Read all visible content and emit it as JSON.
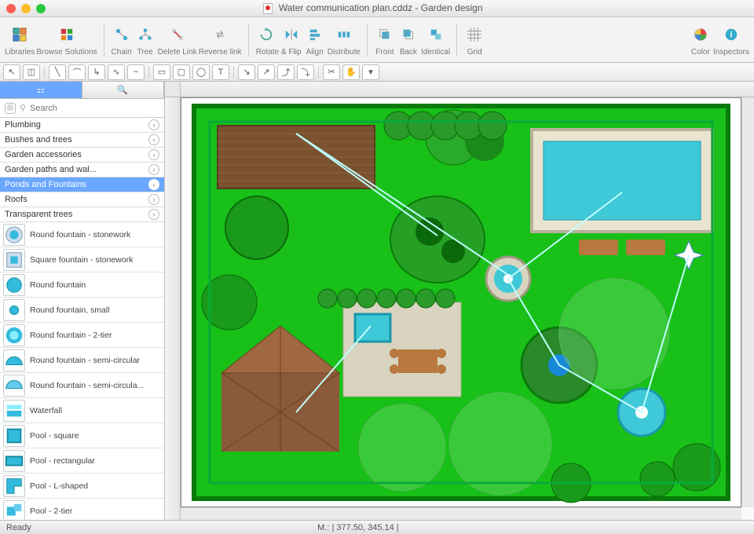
{
  "window": {
    "title": "Water communication plan.cddz - Garden design"
  },
  "toolbar": {
    "groups": [
      {
        "label": "Libraries",
        "icons": [
          "libraries"
        ]
      },
      {
        "label": "Browse Solutions",
        "icons": [
          "solutions"
        ]
      },
      {
        "sep": true
      },
      {
        "label": "Chain",
        "icons": [
          "chain"
        ]
      },
      {
        "label": "Tree",
        "icons": [
          "tree"
        ]
      },
      {
        "label": "Delete Link",
        "icons": [
          "delete-link"
        ]
      },
      {
        "label": "Reverse link",
        "icons": [
          "reverse-link"
        ]
      },
      {
        "sep": true
      },
      {
        "label": "Rotate & Flip",
        "icons": [
          "rotate",
          "flip"
        ]
      },
      {
        "label": "Align",
        "icons": [
          "align"
        ]
      },
      {
        "label": "Distribute",
        "icons": [
          "distribute"
        ]
      },
      {
        "sep": true
      },
      {
        "label": "Front",
        "icons": [
          "front"
        ]
      },
      {
        "label": "Back",
        "icons": [
          "back"
        ]
      },
      {
        "label": "Identical",
        "icons": [
          "identical"
        ]
      },
      {
        "sep": true
      },
      {
        "label": "Grid",
        "icons": [
          "grid"
        ]
      },
      {
        "spacer": true
      },
      {
        "label": "Color",
        "icons": [
          "color"
        ]
      },
      {
        "label": "Inspectors",
        "icons": [
          "inspectors"
        ]
      }
    ]
  },
  "sidebar": {
    "search_placeholder": "Search",
    "categories": [
      {
        "label": "Plumbing"
      },
      {
        "label": "Bushes and trees"
      },
      {
        "label": "Garden accessories"
      },
      {
        "label": "Garden paths and wal..."
      },
      {
        "label": "Ponds and Fountains",
        "selected": true
      },
      {
        "label": "Roofs"
      },
      {
        "label": "Transparent trees"
      }
    ],
    "items": [
      {
        "label": "Round fountain - stonework",
        "thumb": "round-stone"
      },
      {
        "label": "Square fountain - stonework",
        "thumb": "square-stone"
      },
      {
        "label": "Round fountain",
        "thumb": "round"
      },
      {
        "label": "Round fountain, small",
        "thumb": "round-small"
      },
      {
        "label": "Round fountain - 2-tier",
        "thumb": "round-2tier"
      },
      {
        "label": "Round fountain - semi-circular",
        "thumb": "semi1"
      },
      {
        "label": "Round fountain - semi-circula...",
        "thumb": "semi2"
      },
      {
        "label": "Waterfall",
        "thumb": "waterfall"
      },
      {
        "label": "Pool - square",
        "thumb": "pool-sq"
      },
      {
        "label": "Pool - rectangular",
        "thumb": "pool-rect"
      },
      {
        "label": "Pool - L-shaped",
        "thumb": "pool-l"
      },
      {
        "label": "Pool - 2-tier",
        "thumb": "pool-2t"
      }
    ]
  },
  "status": {
    "ready": "Ready",
    "coords": "M.: | 377.50, 345.14 |"
  }
}
